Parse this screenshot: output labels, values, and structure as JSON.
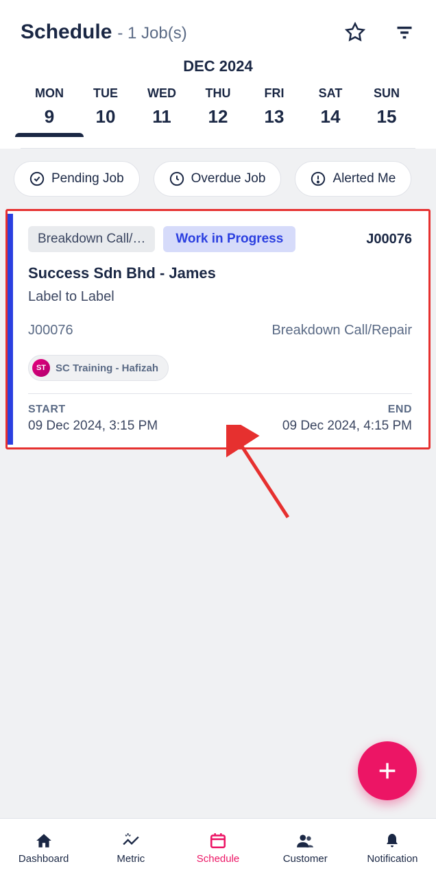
{
  "header": {
    "title": "Schedule",
    "subtitle": "- 1 Job(s)"
  },
  "month": "DEC 2024",
  "week": [
    {
      "name": "MON",
      "num": "9",
      "active": true
    },
    {
      "name": "TUE",
      "num": "10",
      "active": false
    },
    {
      "name": "WED",
      "num": "11",
      "active": false
    },
    {
      "name": "THU",
      "num": "12",
      "active": false
    },
    {
      "name": "FRI",
      "num": "13",
      "active": false
    },
    {
      "name": "SAT",
      "num": "14",
      "active": false
    },
    {
      "name": "SUN",
      "num": "15",
      "active": false
    }
  ],
  "filters": {
    "pending": "Pending Job",
    "overdue": "Overdue Job",
    "alerted": "Alerted Me"
  },
  "job": {
    "type_tag": "Breakdown Call/…",
    "status_tag": "Work in Progress",
    "id": "J00076",
    "company": "Success Sdn Bhd  - James",
    "label_line": "Label to Label",
    "id2": "J00076",
    "type_full": "Breakdown Call/Repair",
    "assignee_initials": "ST",
    "assignee_name": "SC Training - Hafizah",
    "start_label": "START",
    "start_val": "09 Dec 2024, 3:15 PM",
    "end_label": "END",
    "end_val": "09 Dec 2024, 4:15 PM"
  },
  "nav": {
    "dashboard": "Dashboard",
    "metric": "Metric",
    "schedule": "Schedule",
    "customer": "Customer",
    "notification": "Notification"
  }
}
